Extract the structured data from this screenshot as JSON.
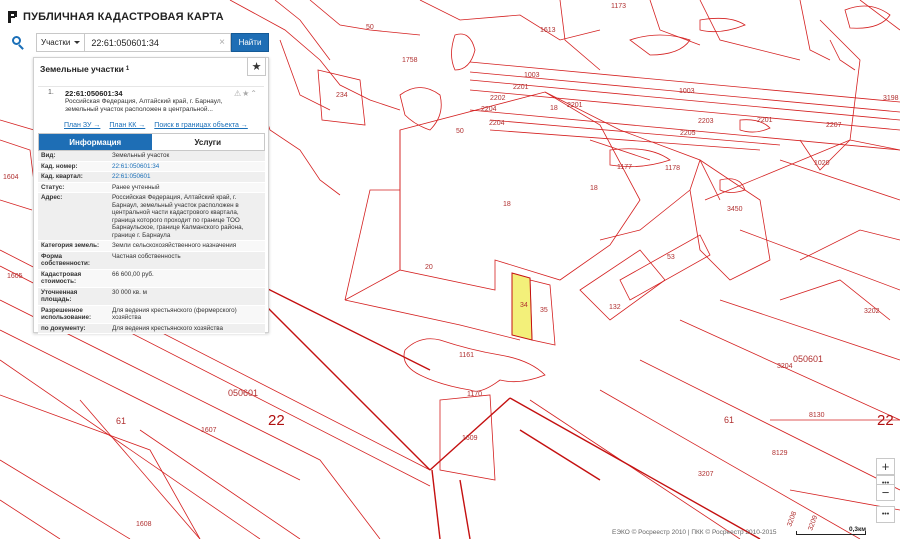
{
  "app": {
    "title": "ПУБЛИЧНАЯ КАДАСТРОВАЯ КАРТА"
  },
  "search": {
    "type_label": "Участки",
    "query": "22:61:050601:34",
    "button_label": "Найти"
  },
  "results": {
    "title": "Земельные участки",
    "count": "1",
    "item": {
      "number": "1.",
      "cad_number": "22:61:050601:34",
      "address_line1": "Российская Федерация, Алтайский край, г. Барнаул,",
      "address_line2": "земельный участок расположен в центральной...",
      "links": [
        "План ЗУ →",
        "План КК →",
        "Поиск в границах объекта →"
      ]
    },
    "tabs": [
      "Информация",
      "Услуги"
    ],
    "properties": [
      {
        "key": "Вид:",
        "value": "Земельный участок"
      },
      {
        "key": "Кад. номер:",
        "value": "22:61:050601:34"
      },
      {
        "key": "Кад. квартал:",
        "value": "22:61:050601"
      },
      {
        "key": "Статус:",
        "value": "Ранее учтенный"
      },
      {
        "key": "Адрес:",
        "value": "Российская Федерация, Алтайский край, г. Барнаул, земельный участок расположен в центральной части кадастрового квартала, граница которого проходит по границе ТОО Барнаульское, границе Калманского района, границе г. Барнаула"
      },
      {
        "key": "Категория земель:",
        "value": "Земли сельскохозяйственного назначения"
      },
      {
        "key": "Форма собственности:",
        "value": "Частная собственность"
      },
      {
        "key": "Кадастровая стоимость:",
        "value": "66 600,00 руб."
      },
      {
        "key": "Уточненная площадь:",
        "value": "30 000 кв. м"
      },
      {
        "key": "Разрешенное использование:",
        "value": "Для ведения крестьянского (фермерского) хозяйства"
      },
      {
        "key": "по документу:",
        "value": "Для ведения крестьянского хозяйства"
      }
    ]
  },
  "map": {
    "labels": {
      "p1173": "1173",
      "p50a": "50",
      "p1613": "1613",
      "p1758": "1758",
      "p234": "234",
      "p1003a": "1003",
      "p2201a": "2201",
      "p1003b": "1003",
      "p2202": "2202",
      "p2204": "2204",
      "p2201b": "2201",
      "p2203": "2203",
      "p2201c": "2201",
      "p2207": "2207",
      "p2204b": "2204",
      "p18a": "18",
      "p50b": "50",
      "p3198": "3198",
      "p2205": "2205",
      "p1020": "1020",
      "p1177": "1177",
      "p1178": "1178",
      "p18b": "18",
      "p18c": "18",
      "p3450": "3450",
      "p1604": "1604",
      "p20": "20",
      "p53": "53",
      "p1605": "1605",
      "p34": "34",
      "p35": "35",
      "p132": "132",
      "p3202": "3202",
      "q050601a": "050601",
      "p1161": "1161",
      "p3204": "3204",
      "q050601b": "050601",
      "p1170": "1170",
      "p8130": "8130",
      "p61a": "61",
      "p22a": "22",
      "p1607": "1607",
      "p61b": "61",
      "p22b": "22",
      "p1609": "1609",
      "p8129": "8129",
      "p3207": "3207",
      "p1608": "1608",
      "p3208": "3208",
      "p3209": "3209"
    },
    "attribution": "ЕЭКО © Росреестр 2010 | ПКК © Росреестр 2010-2015",
    "scale": "0,3км",
    "selected_color": "#f3f07a",
    "line_color": "#d42020"
  },
  "controls": {
    "zoom_in": "+",
    "zoom_out": "−",
    "more": "•••"
  }
}
